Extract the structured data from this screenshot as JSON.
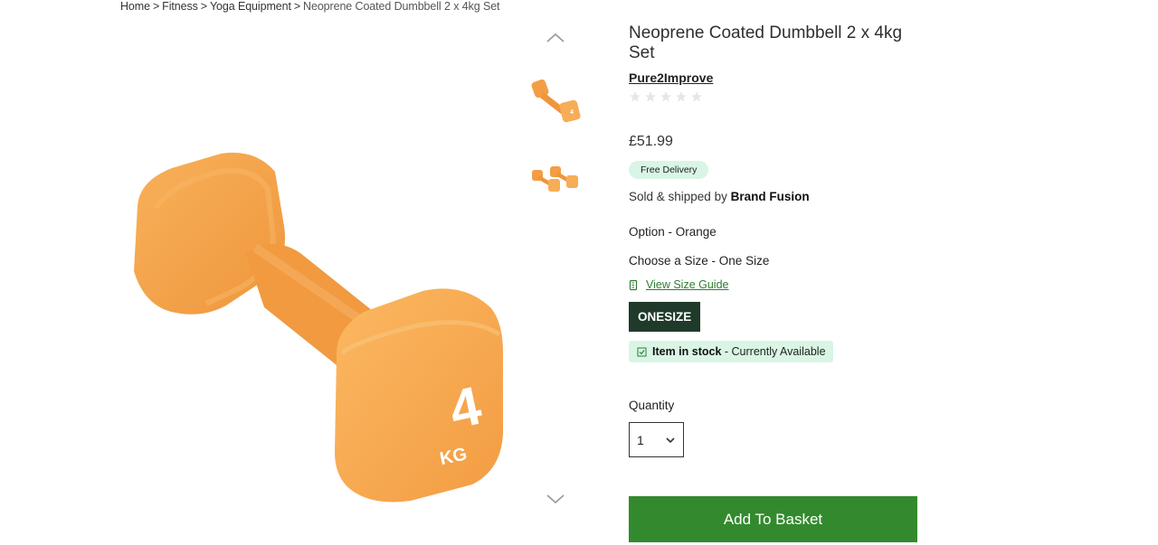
{
  "breadcrumb": {
    "items": [
      "Home",
      "Fitness",
      "Yoga Equipment"
    ],
    "current": "Neoprene Coated Dumbbell 2 x 4kg Set",
    "separator": ">"
  },
  "product": {
    "title": "Neoprene Coated Dumbbell 2 x 4kg Set",
    "brand": "Pure2Improve",
    "rating_stars": 0,
    "rating_max": 5,
    "price": "£51.99",
    "delivery_badge": "Free Delivery",
    "sold_prefix": "Sold & shipped by ",
    "seller": "Brand Fusion",
    "option_label": "Option - Orange",
    "size_label": "Choose a Size - One Size",
    "size_guide": "View Size Guide",
    "size_button": "ONESIZE",
    "stock_bold": "Item in stock",
    "stock_rest": " - Currently Available",
    "quantity_label": "Quantity",
    "quantity_value": "1",
    "add_button": "Add To Basket",
    "image_text": "4",
    "image_unit": "KG"
  },
  "colors": {
    "accent_green": "#338a2e",
    "dark_green": "#1f3a2b",
    "badge_bg": "#d9f5e5",
    "dumbbell": "#f5a24a"
  },
  "icons": {
    "scroll_up": "chevron-up-icon",
    "scroll_down": "chevron-down-icon",
    "size_guide": "ruler-icon",
    "stock": "check-box-icon",
    "select_arrow": "chevron-down-icon"
  }
}
